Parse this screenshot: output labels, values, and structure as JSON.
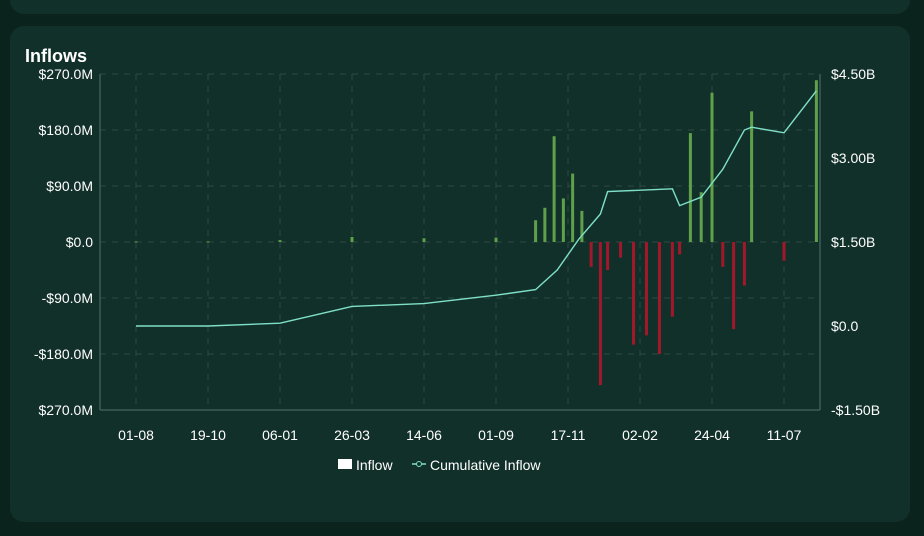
{
  "card": {
    "title": "Inflows"
  },
  "chart_data": {
    "type": "bar",
    "title": "Inflows",
    "x_ticks": [
      "01-08",
      "19-10",
      "06-01",
      "26-03",
      "14-06",
      "01-09",
      "17-11",
      "02-02",
      "24-04",
      "11-07"
    ],
    "y_left": {
      "ticks": [
        "$270.0M",
        "$180.0M",
        "$90.0M",
        "$0.0",
        "-$90.0M",
        "-$180.0M",
        "$270.0M"
      ],
      "range": [
        -270,
        270
      ],
      "unit": "M"
    },
    "y_right": {
      "ticks": [
        "$4.50B",
        "$3.00B",
        "$1.50B",
        "$0.0",
        "-$1.50B"
      ],
      "range": [
        -1.5,
        4.5
      ],
      "unit": "B"
    },
    "legend": {
      "placement": "bottom",
      "items": [
        "Inflow",
        "Cumulative Inflow"
      ]
    },
    "colors": {
      "positive": "#5fa04a",
      "negative": "#a3172a",
      "cumulative": "#7fe0c8",
      "grid": "#2c4a43"
    },
    "series": [
      {
        "name": "Inflow",
        "kind": "bar",
        "points": [
          [
            "01-08",
            1
          ],
          [
            "19-10",
            1
          ],
          [
            "06-01",
            3
          ],
          [
            "26-03",
            8
          ],
          [
            "14-06",
            6
          ],
          [
            "01-09",
            7
          ],
          [
            "17-11",
            35
          ],
          [
            "17-11",
            55
          ],
          [
            "17-11",
            170
          ],
          [
            "17-11",
            70
          ],
          [
            "17-11",
            110
          ],
          [
            "17-11",
            50
          ],
          [
            "17-11",
            -40
          ],
          [
            "17-11",
            -230
          ],
          [
            "02-02",
            -45
          ],
          [
            "02-02",
            -25
          ],
          [
            "02-02",
            -165
          ],
          [
            "02-02",
            -150
          ],
          [
            "02-02",
            -180
          ],
          [
            "02-02",
            -120
          ],
          [
            "24-04",
            -20
          ],
          [
            "24-04",
            175
          ],
          [
            "24-04",
            80
          ],
          [
            "24-04",
            240
          ],
          [
            "24-04",
            -40
          ],
          [
            "24-04",
            -140
          ],
          [
            "24-04",
            -70
          ],
          [
            "11-07",
            210
          ],
          [
            "11-07",
            -30
          ],
          [
            "11-07",
            260
          ]
        ]
      },
      {
        "name": "Cumulative Inflow",
        "kind": "line",
        "points": [
          [
            "01-08",
            0.0
          ],
          [
            "19-10",
            0.0
          ],
          [
            "06-01",
            0.05
          ],
          [
            "26-03",
            0.35
          ],
          [
            "14-06",
            0.4
          ],
          [
            "01-09",
            0.55
          ],
          [
            "17-11",
            0.65
          ],
          [
            "17-11",
            1.0
          ],
          [
            "17-11",
            1.55
          ],
          [
            "17-11",
            2.0
          ],
          [
            "02-02",
            2.4
          ],
          [
            "02-02",
            2.45
          ],
          [
            "24-04",
            2.15
          ],
          [
            "24-04",
            2.3
          ],
          [
            "24-04",
            2.8
          ],
          [
            "24-04",
            3.5
          ],
          [
            "11-07",
            3.55
          ],
          [
            "11-07",
            3.45
          ],
          [
            "11-07",
            4.2
          ]
        ]
      }
    ]
  }
}
